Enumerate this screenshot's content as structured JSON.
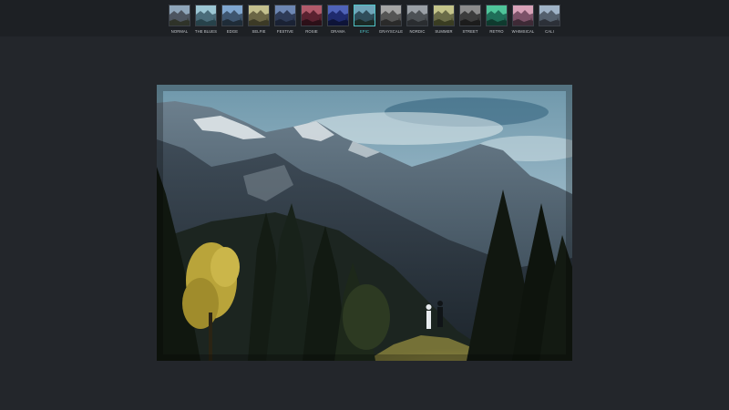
{
  "filters": [
    {
      "id": "normal",
      "label": "NORMAL",
      "sky": "#8fa6ba",
      "mtn": "#4d5560",
      "ground": "#2f3329"
    },
    {
      "id": "the-blues",
      "label": "THE BLUES",
      "sky": "#9cc7d4",
      "mtn": "#4a6c7a",
      "ground": "#27424a"
    },
    {
      "id": "edge",
      "label": "EDGE",
      "sky": "#7fa6cf",
      "mtn": "#3e556f",
      "ground": "#1f2c38"
    },
    {
      "id": "selfie",
      "label": "SELFIE",
      "sky": "#c4c08e",
      "mtn": "#6b6646",
      "ground": "#3c3a26"
    },
    {
      "id": "festive",
      "label": "FESTIVE",
      "sky": "#6d87b3",
      "mtn": "#2e3b57",
      "ground": "#1a2234"
    },
    {
      "id": "rosie",
      "label": "ROSIE",
      "sky": "#b05a6a",
      "mtn": "#5a2230",
      "ground": "#2c1018"
    },
    {
      "id": "drama",
      "label": "DRAMA",
      "sky": "#4f63b8",
      "mtn": "#1f2b6e",
      "ground": "#0e1438"
    },
    {
      "id": "epic",
      "label": "EPIC",
      "sky": "#6fa4b8",
      "mtn": "#2f4d5a",
      "ground": "#1b2a26"
    },
    {
      "id": "grayscale",
      "label": "GRAYSCALE",
      "sky": "#a5a5a5",
      "mtn": "#555555",
      "ground": "#2a2a2a"
    },
    {
      "id": "nordic",
      "label": "NORDIC",
      "sky": "#9aa0a6",
      "mtn": "#4c5155",
      "ground": "#2a2d30"
    },
    {
      "id": "summer",
      "label": "SUMMER",
      "sky": "#c4c48a",
      "mtn": "#6a6c48",
      "ground": "#3a3d22"
    },
    {
      "id": "street",
      "label": "STREET",
      "sky": "#8c8c8c",
      "mtn": "#3c3c3c",
      "ground": "#1c1c1c"
    },
    {
      "id": "retro",
      "label": "RETRO",
      "sky": "#4fc59a",
      "mtn": "#1f6e58",
      "ground": "#0f3a2e"
    },
    {
      "id": "whimsical",
      "label": "WHIMSICAL",
      "sky": "#d8a2b8",
      "mtn": "#7c5268",
      "ground": "#3e2a36"
    },
    {
      "id": "cali",
      "label": "CALI",
      "sky": "#9fb3c7",
      "mtn": "#54606d",
      "ground": "#2c3038"
    }
  ],
  "selected_filter": "EPIC",
  "colors": {
    "selected_accent": "#4fc3c7",
    "background": "#23262b",
    "toolbar": "#1d2024"
  }
}
